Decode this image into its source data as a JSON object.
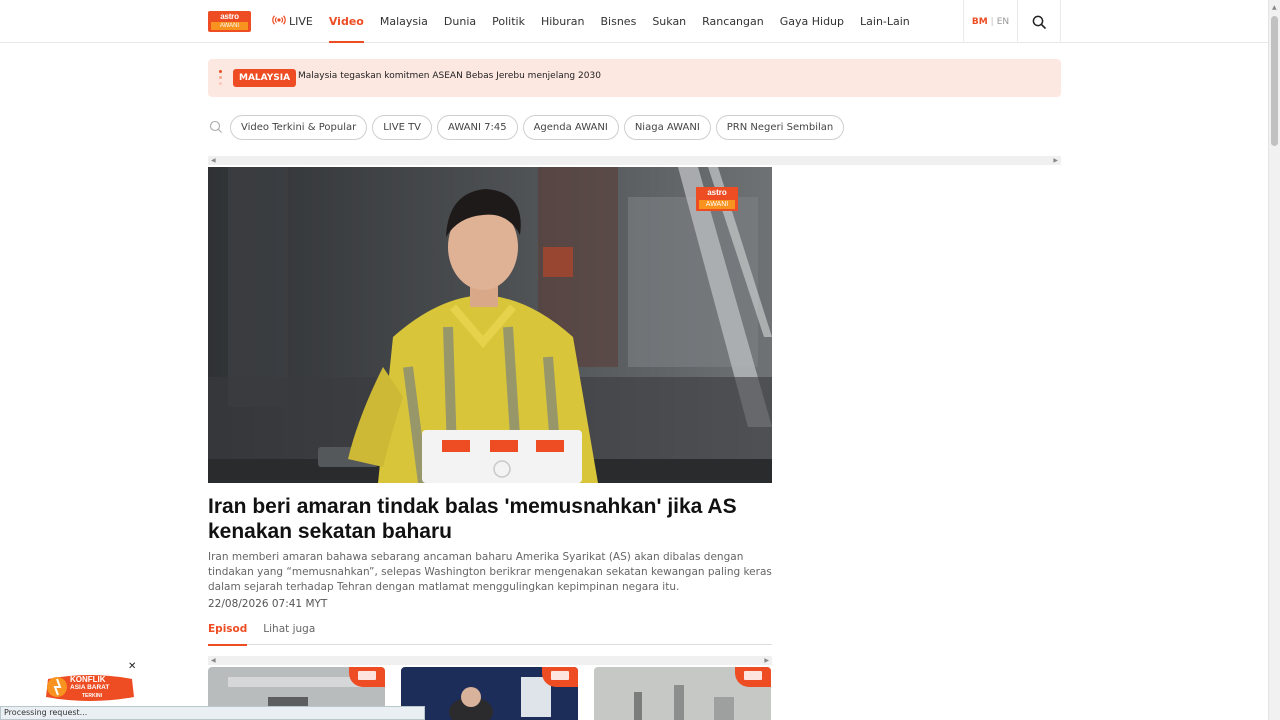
{
  "header": {
    "logo_top": "astro",
    "logo_bottom": "AWANI",
    "nav": [
      {
        "label": "LIVE",
        "active": false
      },
      {
        "label": "Video",
        "active": true
      },
      {
        "label": "Malaysia",
        "active": false
      },
      {
        "label": "Dunia",
        "active": false
      },
      {
        "label": "Politik",
        "active": false
      },
      {
        "label": "Hiburan",
        "active": false
      },
      {
        "label": "Bisnes",
        "active": false
      },
      {
        "label": "Sukan",
        "active": false
      },
      {
        "label": "Rancangan",
        "active": false
      },
      {
        "label": "Gaya Hidup",
        "active": false
      },
      {
        "label": "Lain-Lain",
        "active": false
      }
    ],
    "lang": {
      "bm": "BM",
      "separator": "|",
      "en": "EN"
    },
    "accent": "#ee4d23"
  },
  "ticker": {
    "badge": "MALAYSIA",
    "headline": "Malaysia tegaskan komitmen ASEAN Bebas Jerebu menjelang 2030"
  },
  "tags": [
    "Video Terkini & Popular",
    "LIVE TV",
    "AWANI 7:45",
    "Agenda AWANI",
    "Niaga AWANI",
    "PRN Negeri Sembilan"
  ],
  "video": {
    "watermark_top": "astro",
    "watermark_bottom": "AWANI"
  },
  "article": {
    "title": "Iran beri amaran tindak balas 'memusnahkan' jika AS kenakan sekatan baharu",
    "description": "Iran memberi amaran bahawa sebarang ancaman baharu Amerika Syarikat (AS) akan dibalas dengan tindakan yang “memusnahkan”, selepas Washington berikrar mengenakan sekatan kewangan paling keras dalam sejarah terhadap Tehran dengan matlamat menggulingkan kepimpinan negara itu.",
    "date": "22/08/2026 07:41 MYT"
  },
  "tabs": [
    {
      "label": "Episod",
      "active": true
    },
    {
      "label": "Lihat juga",
      "active": false
    }
  ],
  "promo": {
    "line1": "KONFLIK",
    "line2": "ASIA BARAT",
    "line3": "TERKINI"
  },
  "status_text": "Processing request..."
}
